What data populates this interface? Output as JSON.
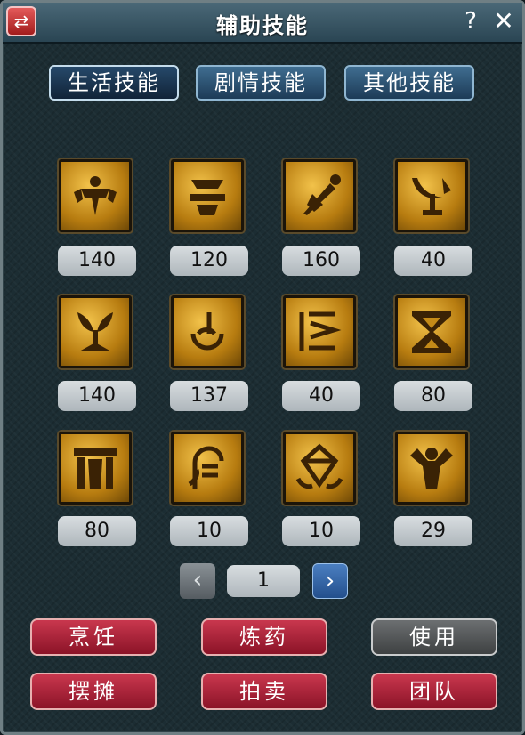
{
  "window": {
    "title": "辅助技能",
    "swap_icon": "⇄",
    "help_label": "?",
    "close_label": "✕"
  },
  "tabs": [
    {
      "label": "生活技能",
      "active": true
    },
    {
      "label": "剧情技能",
      "active": false
    },
    {
      "label": "其他技能",
      "active": false
    }
  ],
  "skills": [
    {
      "icon": "warrior-icon",
      "level": "140"
    },
    {
      "icon": "crafted-helmet-icon",
      "level": "120"
    },
    {
      "icon": "dart-icon",
      "level": "160"
    },
    {
      "icon": "moon-axe-icon",
      "level": "40"
    },
    {
      "icon": "sprout-icon",
      "level": "140"
    },
    {
      "icon": "cauldron-icon",
      "level": "137"
    },
    {
      "icon": "rune-icon",
      "level": "40"
    },
    {
      "icon": "hourglass-icon",
      "level": "80"
    },
    {
      "icon": "pillars-icon",
      "level": "80"
    },
    {
      "icon": "maiden-icon",
      "level": "10"
    },
    {
      "icon": "crystal-icon",
      "level": "10"
    },
    {
      "icon": "strongman-icon",
      "level": "29"
    }
  ],
  "pager": {
    "prev": "‹",
    "page": "1",
    "next": "›"
  },
  "buttons": {
    "cook": "烹饪",
    "alchemy": "炼药",
    "use": "使用",
    "stall": "摆摊",
    "auction": "拍卖",
    "team": "团队"
  }
}
